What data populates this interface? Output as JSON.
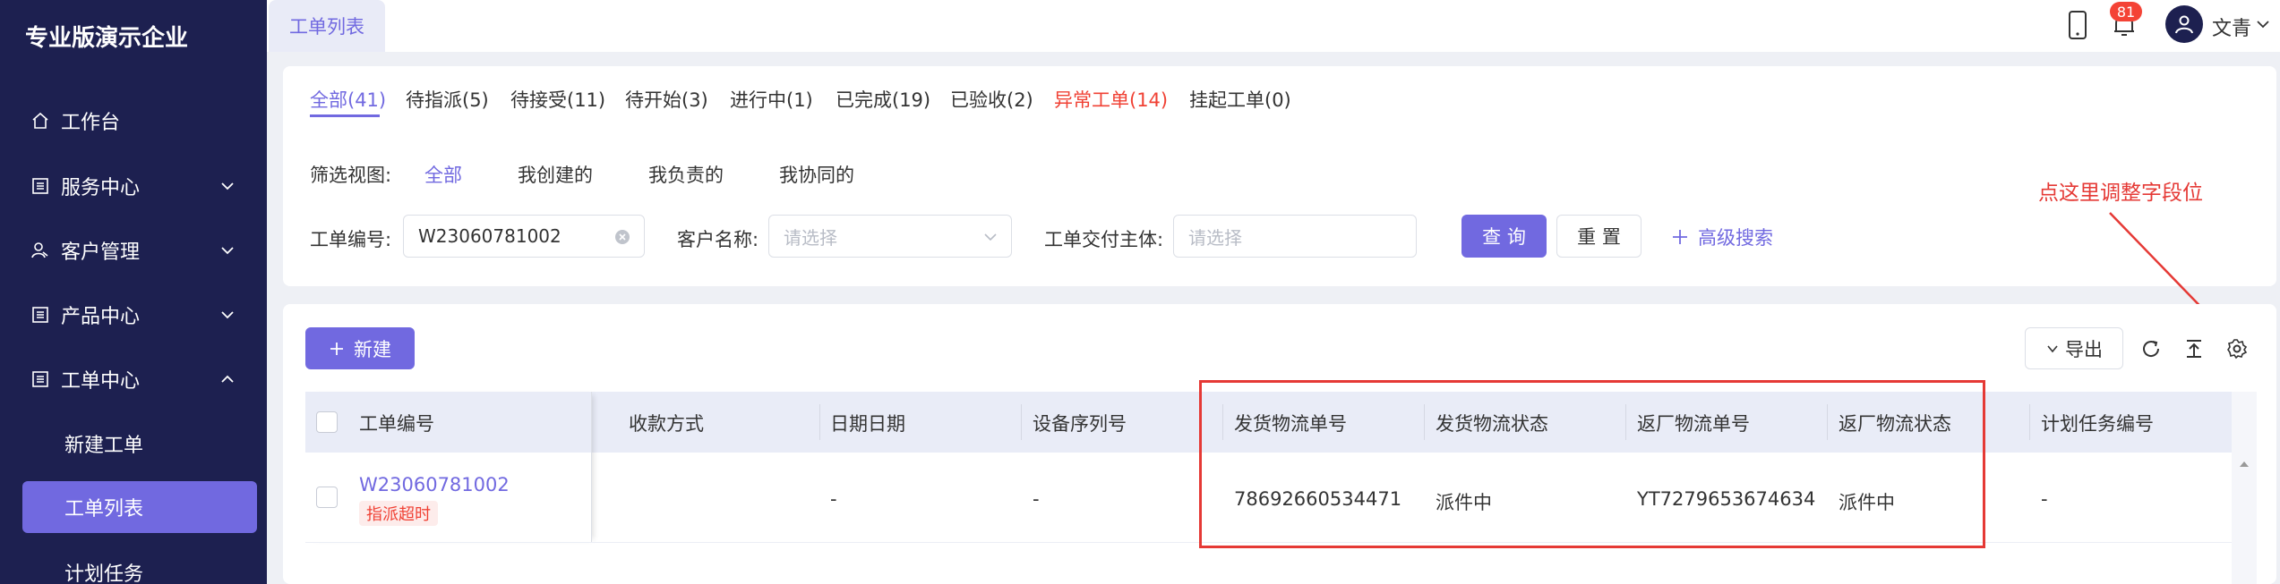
{
  "sidebar": {
    "brand": "专业版演示企业",
    "items": [
      {
        "label": "工作台",
        "icon": "home-icon"
      },
      {
        "label": "服务中心",
        "icon": "list-icon"
      },
      {
        "label": "客户管理",
        "icon": "users-icon"
      },
      {
        "label": "产品中心",
        "icon": "list-icon"
      },
      {
        "label": "工单中心",
        "icon": "list-icon"
      }
    ],
    "sub_items": [
      {
        "label": "新建工单"
      },
      {
        "label": "工单列表",
        "active": true
      },
      {
        "label": "计划任务"
      }
    ]
  },
  "header": {
    "tab": "工单列表",
    "notification_count": "81",
    "user_name": "文青",
    "icons": [
      "phone-icon",
      "bell-icon",
      "user-icon"
    ]
  },
  "status_tabs": [
    {
      "label": "全部(41)",
      "active": true
    },
    {
      "label": "待指派(5)"
    },
    {
      "label": "待接受(11)"
    },
    {
      "label": "待开始(3)"
    },
    {
      "label": "进行中(1)"
    },
    {
      "label": "已完成(19)"
    },
    {
      "label": "已验收(2)"
    },
    {
      "label": "异常工单(14)",
      "danger": true
    },
    {
      "label": "挂起工单(0)"
    }
  ],
  "filter": {
    "view_label": "筛选视图:",
    "views": [
      "全部",
      "我创建的",
      "我负责的",
      "我协同的"
    ],
    "order_no_label": "工单编号:",
    "order_no_value": "W23060781002",
    "customer_label": "客户名称:",
    "customer_placeholder": "请选择",
    "delivery_label": "工单交付主体:",
    "delivery_placeholder": "请选择",
    "query_button": "查 询",
    "reset_button": "重 置",
    "advanced_search": "高级搜索"
  },
  "annotation": {
    "text": "点这里调整字段位",
    "color": "#e53935"
  },
  "toolbar": {
    "new_button": "新建",
    "export_button": "导出",
    "icons": [
      "refresh-icon",
      "upload-icon",
      "settings-icon"
    ]
  },
  "table": {
    "columns": [
      "工单编号",
      "收款方式",
      "日期日期",
      "设备序列号",
      "发货物流单号",
      "发货物流状态",
      "返厂物流单号",
      "返厂物流状态",
      "计划任务编号"
    ],
    "rows": [
      {
        "order_no": "W23060781002",
        "tag": "指派超时",
        "payment": "",
        "date": "-",
        "serial": "-",
        "ship_no": "78692660534471",
        "ship_status": "派件中",
        "return_no": "YT7279653674634",
        "return_status": "派件中",
        "plan_no": "-"
      }
    ]
  },
  "colors": {
    "accent": "#7169e0",
    "sidebar": "#1d2050",
    "danger": "#f04134"
  }
}
